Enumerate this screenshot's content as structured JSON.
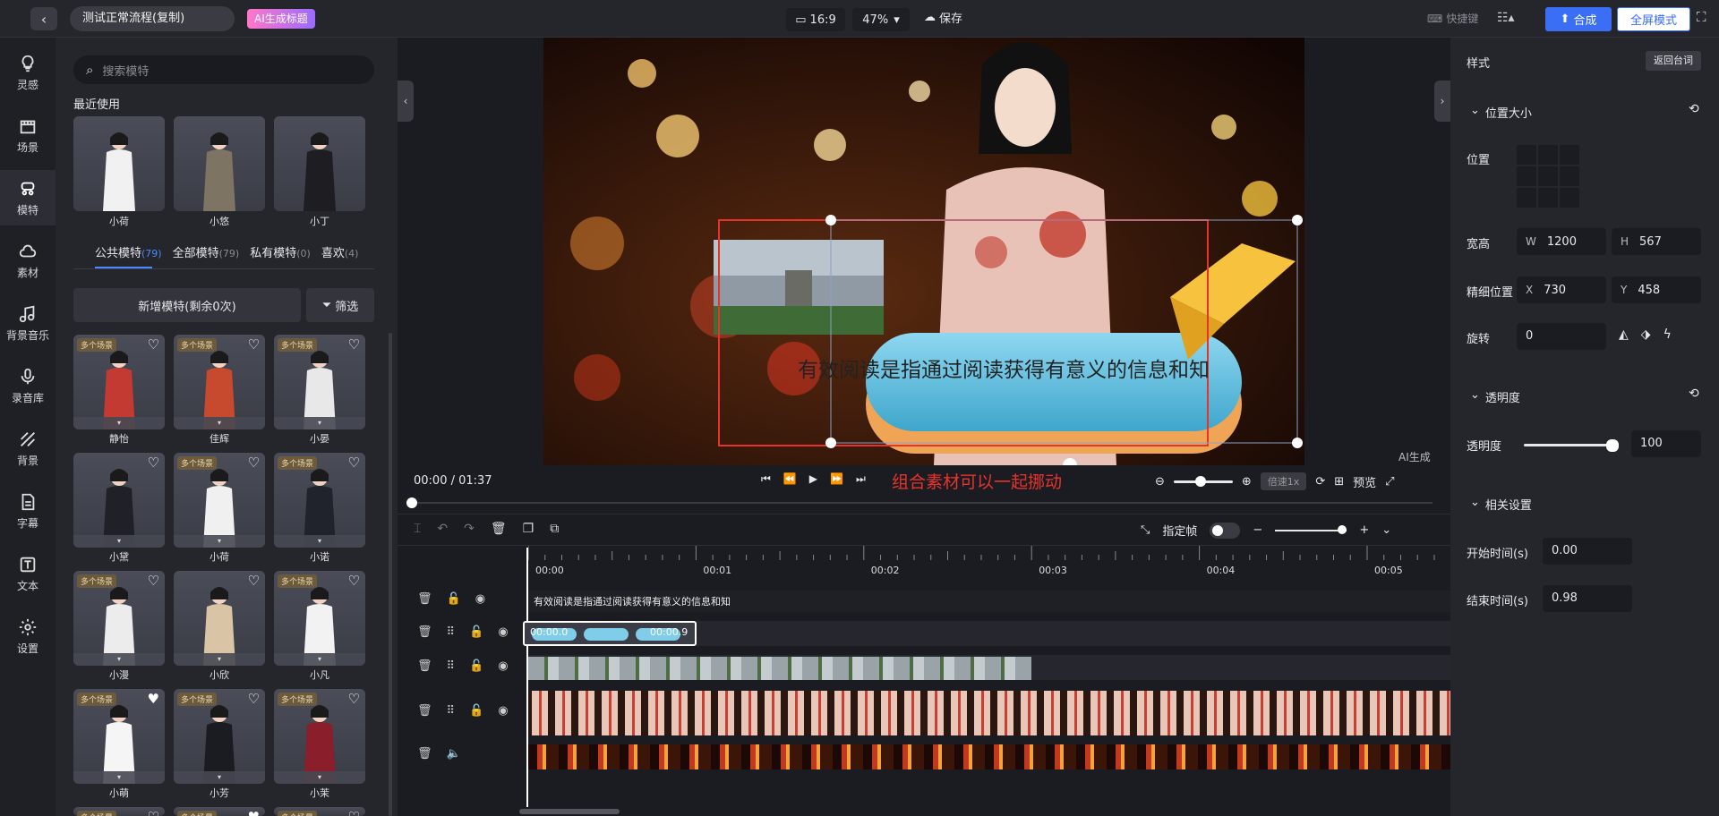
{
  "topbar": {
    "project_name": "测试正常流程(复制)",
    "ai_title_label": "AI生成标题",
    "ratio": "16:9",
    "zoom": "47%",
    "save_label": "保存",
    "shortcut_label": "快捷键",
    "synth_label": "合成",
    "fullscreen_label": "全屏模式"
  },
  "nav": {
    "items": [
      {
        "label": "灵感",
        "icon": "bulb-icon"
      },
      {
        "label": "场景",
        "icon": "clapper-icon"
      },
      {
        "label": "模特",
        "icon": "model-icon"
      },
      {
        "label": "素材",
        "icon": "cloud-icon"
      },
      {
        "label": "背景音乐",
        "icon": "music-icon"
      },
      {
        "label": "录音库",
        "icon": "mic-icon"
      },
      {
        "label": "背景",
        "icon": "stripes-icon"
      },
      {
        "label": "字幕",
        "icon": "doc-icon"
      },
      {
        "label": "文本",
        "icon": "text-icon"
      },
      {
        "label": "设置",
        "icon": "gear-icon"
      }
    ]
  },
  "models": {
    "search_placeholder": "搜索模特",
    "recent_title": "最近使用",
    "recent": [
      "小荷",
      "小悠",
      "小丁"
    ],
    "tabs": [
      {
        "label": "公共模特",
        "count": "(79)"
      },
      {
        "label": "全部模特",
        "count": "(79)"
      },
      {
        "label": "私有模特",
        "count": "(0)"
      },
      {
        "label": "喜欢",
        "count": "(4)"
      }
    ],
    "add_label": "新增模特(剩余0次)",
    "filter_label": "筛选",
    "badge": "多个场景",
    "grid": [
      "静怡",
      "佳辉",
      "小晏",
      "小黛",
      "小荷",
      "小诺",
      "小漫",
      "小欣",
      "小凡",
      "小萌",
      "小芳",
      "小茉"
    ]
  },
  "preview": {
    "overlay_text": "有效阅读是指通过阅读获得有意义的信息和知",
    "ai_badge": "AI生成",
    "time": "00:00 / 01:37",
    "caption_note": "组合素材可以一起挪动",
    "speed": "倍速1x",
    "preview_label": "预览"
  },
  "timeline": {
    "keyframe_label": "指定帧",
    "ruler": [
      "00:00",
      "00:01",
      "00:02",
      "00:03",
      "00:04",
      "00:05"
    ],
    "text_track": "有效阅读是指通过阅读获得有意义的信息和知",
    "clip_start": "00:00.0",
    "clip_end": "00:00.9"
  },
  "panel": {
    "style_title": "样式",
    "back_label": "返回台词",
    "pos_size_title": "位置大小",
    "position_label": "位置",
    "wh_label": "宽高",
    "w_prefix": "W",
    "w": "1200",
    "h_prefix": "H",
    "h": "567",
    "fine_label": "精细位置",
    "x_prefix": "X",
    "x": "730",
    "y_prefix": "Y",
    "y": "458",
    "rotate_label": "旋转",
    "rotate": "0",
    "opacity_title": "透明度",
    "opacity_label": "透明度",
    "opacity": "100",
    "related_title": "相关设置",
    "start_label": "开始时间(s)",
    "start": "0.00",
    "end_label": "结束时间(s)",
    "end": "0.98"
  }
}
